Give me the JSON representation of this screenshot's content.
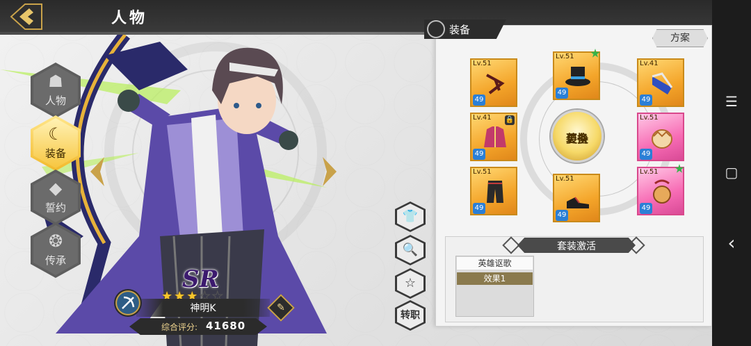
{
  "header": {
    "title": "人物",
    "back_icon": "back-arrow-icon"
  },
  "nav": {
    "items": [
      {
        "label": "人物",
        "icon": "portrait-icon",
        "active": false
      },
      {
        "label": "装备",
        "icon": "equipment-icon",
        "active": true
      },
      {
        "label": "誓约",
        "icon": "crystal-icon",
        "active": false
      },
      {
        "label": "传承",
        "icon": "inheritance-icon",
        "active": false
      }
    ]
  },
  "character": {
    "rarity": "SR",
    "stars_filled": 3,
    "stars_total": 5,
    "name": "神明K",
    "class_icon": "bow-class-icon",
    "score_label": "综合评分:",
    "score_value": "41680"
  },
  "actions": {
    "outfit": "outfit-icon",
    "inspect": "magnify-icon",
    "favorite": "star-icon",
    "job_change": "转职"
  },
  "equipment": {
    "title": "装备",
    "plan_button": "方案",
    "swap_button_line1": "更换",
    "swap_button_line2": "装备",
    "slots": [
      {
        "level": "Lv.51",
        "count": "49",
        "rarity": "gold",
        "item": "claw-accessory-icon"
      },
      {
        "level": "Lv.51",
        "count": "49",
        "rarity": "gold",
        "item": "top-hat-icon",
        "new": true
      },
      {
        "level": "Lv.41",
        "count": "49",
        "rarity": "gold",
        "item": "bracer-icon"
      },
      {
        "level": "Lv.41",
        "count": "49",
        "rarity": "gold",
        "item": "jacket-icon",
        "locked": true
      },
      {
        "level": "Lv.51",
        "count": "49",
        "rarity": "pink",
        "item": "egg-shell-icon"
      },
      {
        "level": "Lv.51",
        "count": "49",
        "rarity": "gold",
        "item": "pants-icon"
      },
      {
        "level": "Lv.51",
        "count": "49",
        "rarity": "gold",
        "item": "shoes-icon"
      },
      {
        "level": "Lv.51",
        "count": "49",
        "rarity": "pink",
        "item": "charm-icon",
        "new": true
      }
    ]
  },
  "set_bonus": {
    "title": "套装激活",
    "name": "英雄讴歌",
    "effect": "效果1"
  },
  "system": {
    "menu": "☰",
    "home": "▢",
    "back": "‹"
  },
  "colors": {
    "gold": "#f4a52a",
    "pink": "#f76bb4",
    "accent": "#c9a24a",
    "dark": "#2c2c2c"
  }
}
